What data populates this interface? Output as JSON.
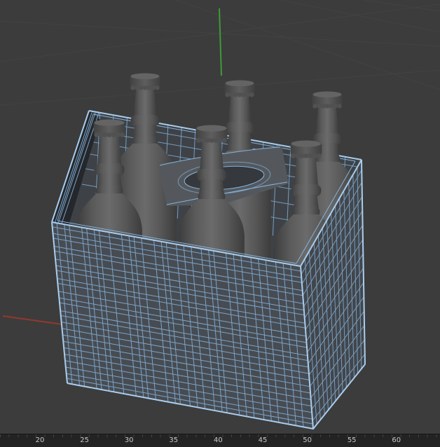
{
  "app": {
    "name": "3d-viewport-six-pack-scene"
  },
  "viewport": {
    "background": "#3c3c3c",
    "grid_line_color": "#464646",
    "axes": {
      "y_axis_color": "#3f9b35",
      "x_axis_color": "#93382e"
    },
    "model": {
      "name": "six-pack-bottle-carrier",
      "bottle_count": 6,
      "selection_wireframe_color": "#86b3dc",
      "selection_edge_color": "#a9cdee",
      "carrier_face_color": "#474c52",
      "carrier_side_color": "#42464b",
      "carrier_interior_color": "#3e4246",
      "carrier_handle_color": "#54585d",
      "handle_hole_color": "#35383c",
      "bottle_color": "#5f5f5f",
      "bottle_cap_color": "#515151",
      "wireframe": {
        "front_vertical_t": [
          0.02,
          0.05,
          0.07,
          0.12,
          0.14,
          0.17,
          0.19,
          0.23,
          0.28,
          0.31,
          0.33,
          0.36,
          0.41,
          0.44,
          0.46,
          0.5,
          0.53,
          0.56,
          0.6,
          0.63,
          0.65,
          0.7,
          0.73,
          0.76,
          0.8,
          0.83,
          0.86,
          0.9,
          0.93,
          0.96
        ],
        "front_horizontal_t": [
          0.03,
          0.07,
          0.1,
          0.15,
          0.18,
          0.23,
          0.27,
          0.3,
          0.35,
          0.38,
          0.43,
          0.47,
          0.5,
          0.55,
          0.58,
          0.62,
          0.66,
          0.7,
          0.74,
          0.78,
          0.82,
          0.86,
          0.9,
          0.94,
          0.97
        ],
        "side_vertical_t": [
          0.07,
          0.14,
          0.22,
          0.29,
          0.36,
          0.43,
          0.5,
          0.57,
          0.64,
          0.71,
          0.79,
          0.86,
          0.93
        ],
        "side_horizontal_t": [
          0.05,
          0.11,
          0.18,
          0.25,
          0.32,
          0.39,
          0.46,
          0.53,
          0.6,
          0.67,
          0.74,
          0.81,
          0.88,
          0.95
        ],
        "interior_vertical_t": [
          0.04,
          0.09,
          0.14,
          0.19,
          0.24,
          0.29,
          0.34,
          0.39,
          0.44,
          0.49,
          0.54,
          0.59,
          0.64,
          0.69,
          0.74,
          0.79,
          0.84,
          0.89,
          0.94
        ],
        "interior_horizontal_offsets": [
          12,
          26,
          42,
          60,
          82,
          105
        ]
      }
    }
  },
  "ruler": {
    "labels": [
      "20",
      "25",
      "30",
      "35",
      "40",
      "45",
      "50",
      "55",
      "60"
    ],
    "text_color": "#c8c8c8",
    "background": "#232323"
  }
}
